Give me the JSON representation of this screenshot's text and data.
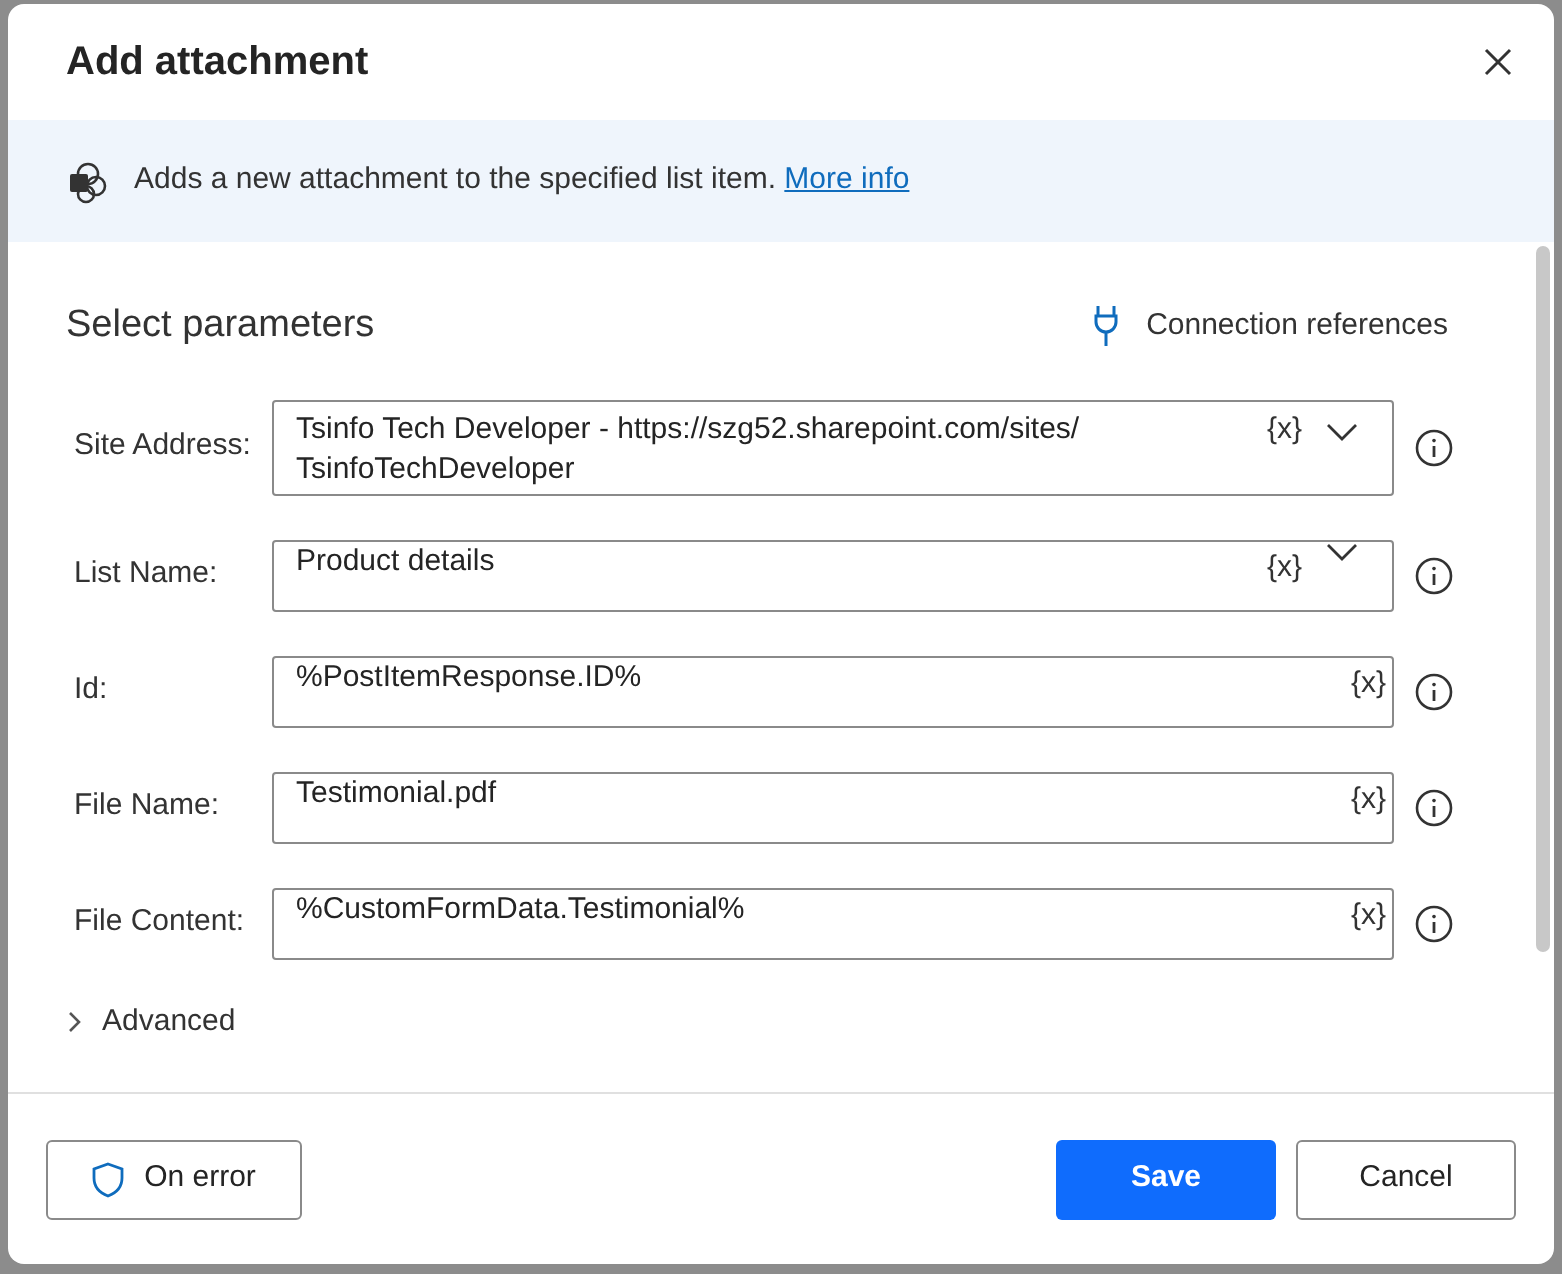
{
  "dialog": {
    "title": "Add attachment"
  },
  "info": {
    "text": "Adds a new attachment to the specified list item.",
    "link": "More info"
  },
  "section": {
    "title": "Select parameters",
    "connection_link": "Connection references"
  },
  "fields": [
    {
      "label": "Site Address:",
      "kind": "dropdown",
      "value": "Tsinfo Tech Developer - https://szg52.sharepoint.com/sites/ TsinfoTechDeveloper",
      "variable_token": "{x}"
    },
    {
      "label": "List Name:",
      "kind": "dropdown",
      "value": "Product details",
      "variable_token": "{x}"
    },
    {
      "label": "Id:",
      "kind": "text",
      "value": "%PostItemResponse.ID%",
      "variable_token": "{x}"
    },
    {
      "label": "File Name:",
      "kind": "text",
      "value": "Testimonial.pdf",
      "variable_token": "{x}"
    },
    {
      "label": "File Content:",
      "kind": "text",
      "value": "%CustomFormData.Testimonial%",
      "variable_token": "{x}"
    }
  ],
  "advanced": {
    "label": "Advanced",
    "expanded": false
  },
  "footer": {
    "on_error": "On error",
    "save": "Save",
    "cancel": "Cancel"
  }
}
